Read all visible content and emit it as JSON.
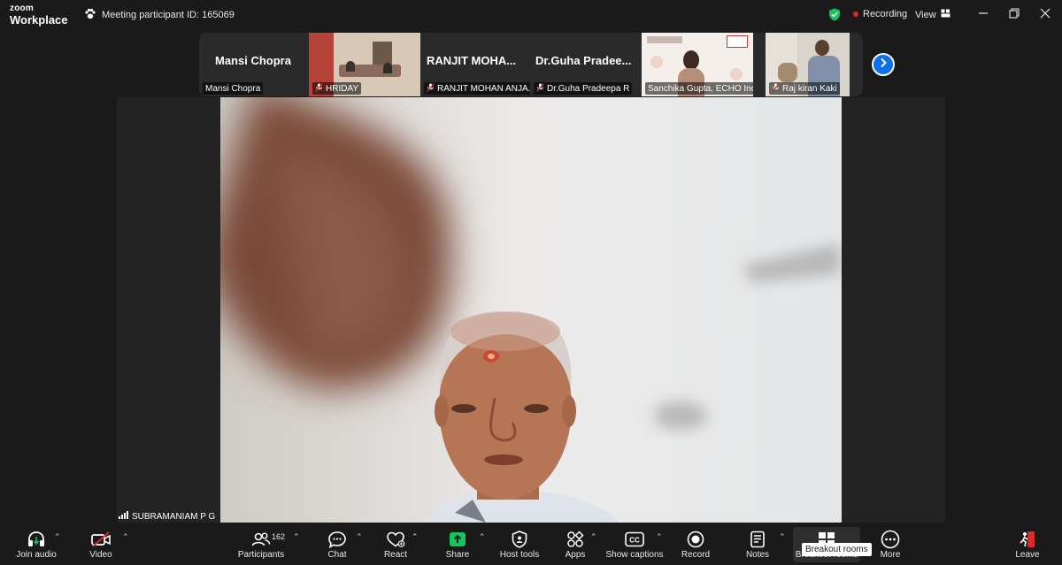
{
  "app": {
    "logo_top": "zoom",
    "logo_bottom": "Workplace"
  },
  "header": {
    "meeting_id_label": "Meeting participant ID: 165069",
    "recording_label": "Recording",
    "view_label": "View"
  },
  "thumbnails": [
    {
      "name": "Mansi Chopra",
      "label": "Mansi Chopra",
      "muted": false
    },
    {
      "name": "",
      "label": "HRIDAY",
      "muted": true
    },
    {
      "name": "RANJIT  MOHA...",
      "label": "RANJIT MOHAN ANJA...",
      "muted": true
    },
    {
      "name": "Dr.Guha  Pradee...",
      "label": "Dr.Guha Pradeepa R",
      "muted": true
    },
    {
      "name": "",
      "label": "Sanchika Gupta, ECHO Ind...",
      "muted": false
    },
    {
      "name": "",
      "label": "Raj kiran Kaki",
      "muted": true
    }
  ],
  "main_video": {
    "speaker_label": "SUBRAMANIAM P G"
  },
  "toolbar": {
    "join_audio": "Join audio",
    "video": "Video",
    "participants": "Participants",
    "participants_count": "162",
    "chat": "Chat",
    "react": "React",
    "share": "Share",
    "host_tools": "Host tools",
    "apps": "Apps",
    "show_captions": "Show captions",
    "record": "Record",
    "notes": "Notes",
    "breakout_rooms": "Breakout rooms",
    "more": "More",
    "leave": "Leave",
    "tooltip": "Breakout rooms"
  },
  "colors": {
    "accent": "#0e71eb",
    "recording": "#e02828",
    "share": "#17c35e",
    "leave": "#e02828",
    "secure": "#17c35e"
  }
}
